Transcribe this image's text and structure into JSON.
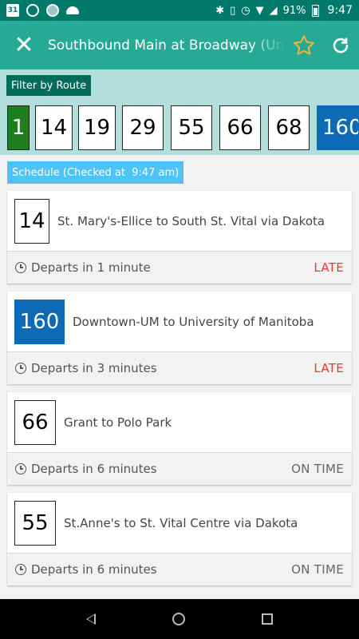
{
  "status_bar": {
    "calendar_day": "31",
    "battery": "91%",
    "time": "9:47"
  },
  "app_bar": {
    "title": "Southbound Main at Broadway (Union Station)"
  },
  "filter": {
    "label": "Filter by Route",
    "routes": [
      "1",
      "14",
      "19",
      "29",
      "55",
      "66",
      "68",
      "160"
    ],
    "selected": "1"
  },
  "schedule": {
    "label": "Schedule (Checked at  9:47 am)",
    "items": [
      {
        "route": "14",
        "description": "St. Mary's-Ellice to South St. Vital via Dakota",
        "departs": "Departs in 1 minute",
        "status": "LATE"
      },
      {
        "route": "160",
        "description": "Downtown-UM to University of Manitoba",
        "departs": "Departs in 3 minutes",
        "status": "LATE"
      },
      {
        "route": "66",
        "description": "Grant to Polo Park",
        "departs": "Departs in 6 minutes",
        "status": "ON TIME"
      },
      {
        "route": "55",
        "description": "St.Anne's to St. Vital Centre via Dakota",
        "departs": "Departs in 6 minutes",
        "status": "ON TIME"
      }
    ]
  },
  "colors": {
    "status_bar": "#00796b",
    "app_bar": "#26a995",
    "filter_bg": "#b2dfdb",
    "filter_label": "#006d5b",
    "selected_route": "#1e7d1e",
    "route_160": "#0d6ab7",
    "schedule_chip": "#4fc3f7",
    "late": "#e53935",
    "star": "#f0b43c"
  },
  "icons": {
    "close": "close-icon",
    "star": "star-icon",
    "refresh": "refresh-icon",
    "clock": "clock-icon"
  }
}
